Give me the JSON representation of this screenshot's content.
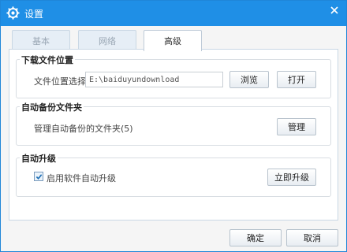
{
  "window": {
    "title": "设置"
  },
  "tabs": [
    {
      "label": "基本"
    },
    {
      "label": "网络"
    },
    {
      "label": "高级"
    }
  ],
  "download_group": {
    "title": "下载文件位置",
    "location_label": "文件位置选择",
    "path_value": "E:\\baiduyundownload",
    "browse_label": "浏览",
    "open_label": "打开"
  },
  "backup_group": {
    "title": "自动备份文件夹",
    "manage_text": "管理自动备份的文件夹(5)",
    "manage_label": "管理"
  },
  "upgrade_group": {
    "title": "自动升级",
    "auto_upgrade_label": "启用软件自动升级",
    "auto_upgrade_checked": true,
    "upgrade_now_label": "立即升级"
  },
  "footer": {
    "ok_label": "确定",
    "cancel_label": "取消"
  },
  "colors": {
    "titlebar": "#1f8fe6",
    "border": "#1f86d8"
  }
}
